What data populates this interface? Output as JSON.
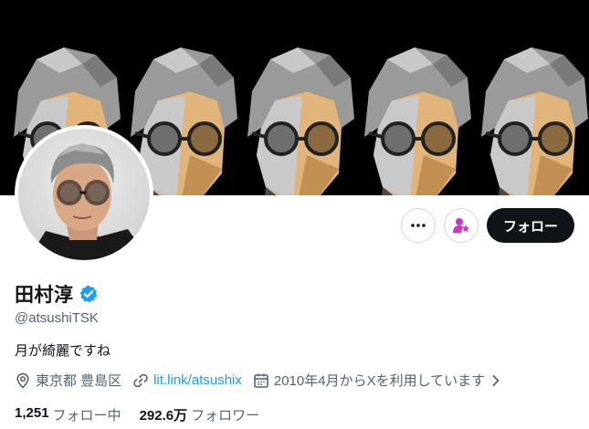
{
  "profile": {
    "name": "田村淳",
    "handle": "@atsushiTSK",
    "bio": "月が綺麗ですね",
    "location": "東京都 豊島区",
    "link": "lit.link/atsushix",
    "joined": "2010年4月からXを利用しています",
    "verified_icon": "verified-badge-icon"
  },
  "actions": {
    "more_icon": "more-icon",
    "subscribe_icon": "subscribe-star-icon",
    "follow_label": "フォロー"
  },
  "stats": {
    "following_count": "1,251",
    "following_label": "フォロー中",
    "followers_count": "292.6万",
    "followers_label": "フォロワー"
  },
  "colors": {
    "accent": "#1d9bf0",
    "subscribe": "#c936c9",
    "text": "#0f1419",
    "muted": "#536471",
    "banner_bg": "#000000"
  }
}
